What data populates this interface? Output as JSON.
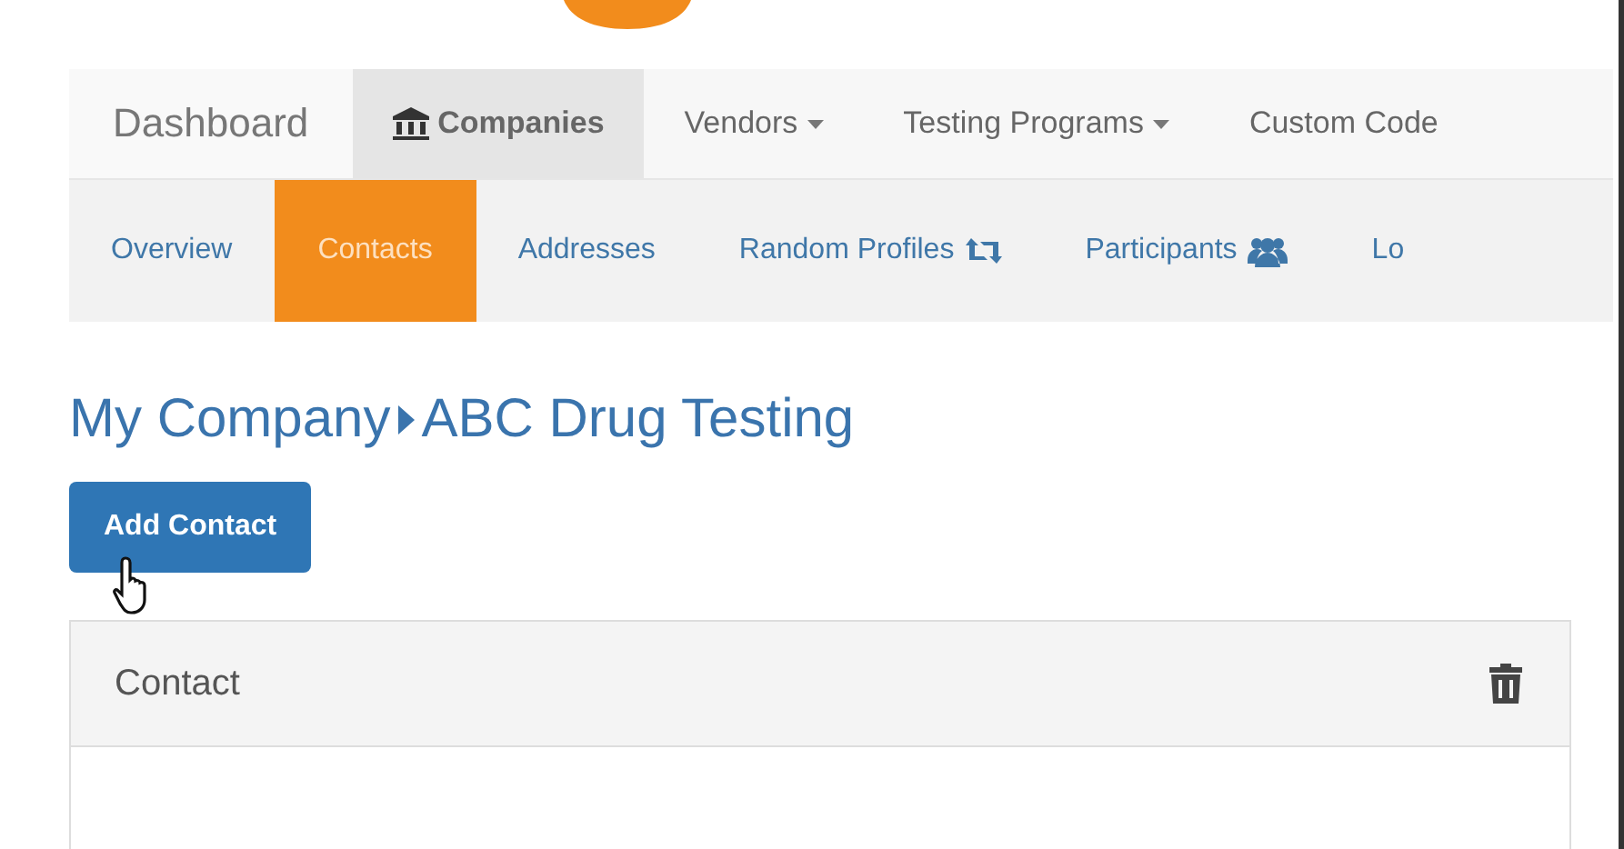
{
  "top_nav": [
    {
      "label": "Dashboard",
      "kind": "brand",
      "selected": false
    },
    {
      "label": "Companies",
      "kind": "institution",
      "selected": true
    },
    {
      "label": "Vendors",
      "kind": "dropdown",
      "selected": false
    },
    {
      "label": "Testing Programs",
      "kind": "dropdown",
      "selected": false
    },
    {
      "label": "Custom Code",
      "kind": "plain",
      "selected": false
    }
  ],
  "sub_nav": [
    {
      "label": "Overview",
      "kind": "plain",
      "selected": false
    },
    {
      "label": "Contacts",
      "kind": "plain",
      "selected": true
    },
    {
      "label": "Addresses",
      "kind": "plain",
      "selected": false
    },
    {
      "label": "Random Profiles",
      "kind": "rotation",
      "selected": false
    },
    {
      "label": "Participants",
      "kind": "people",
      "selected": false
    },
    {
      "label": "Lo",
      "kind": "plain",
      "selected": false
    }
  ],
  "breadcrumb": {
    "parent": "My Company",
    "current": "ABC Drug Testing"
  },
  "add_button": "Add Contact",
  "panel": {
    "title": "Contact"
  }
}
